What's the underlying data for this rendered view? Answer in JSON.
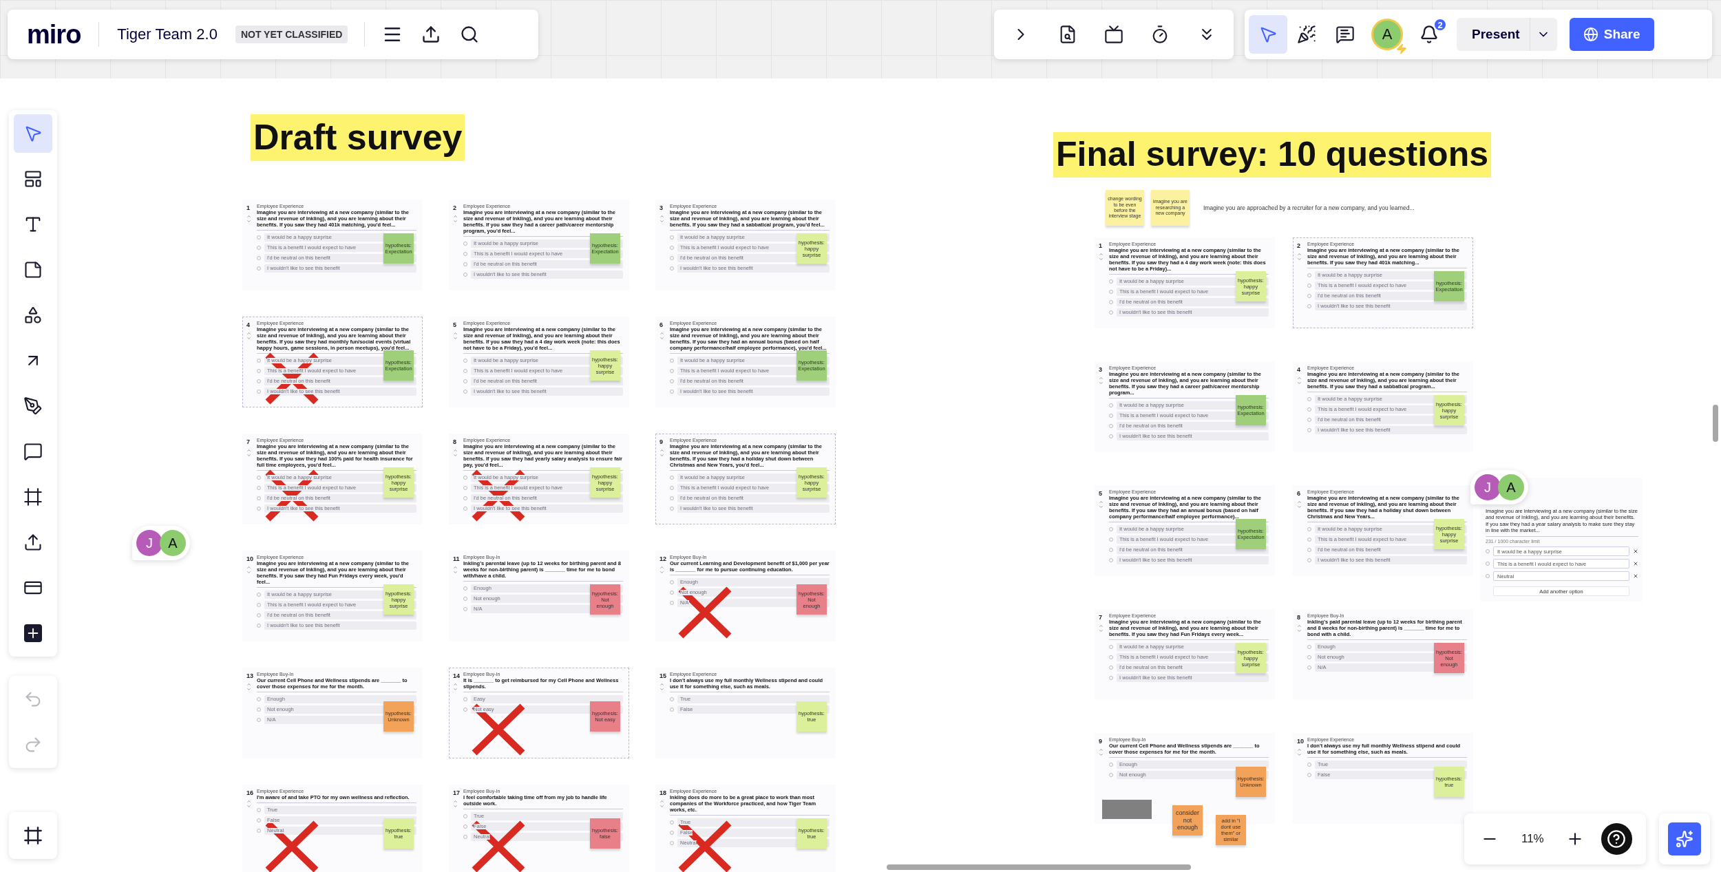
{
  "header": {
    "logo": "miro",
    "board_title": "Tiger Team 2.0",
    "classification": "NOT YET CLASSIFIED"
  },
  "top_tools": [
    {
      "kind": "expand"
    },
    {
      "kind": "notes"
    },
    {
      "kind": "screen"
    },
    {
      "kind": "timer"
    },
    {
      "kind": "more"
    }
  ],
  "collab_tools": [
    {
      "kind": "pointer",
      "selected": true
    },
    {
      "kind": "reactions",
      "selected": false
    },
    {
      "kind": "comments",
      "selected": false
    }
  ],
  "user": {
    "initial": "A"
  },
  "notifications": {
    "count": "2"
  },
  "present_button": "Present",
  "share_button": "Share",
  "left_tools": [
    {
      "kind": "select",
      "selected": true
    },
    {
      "kind": "templates",
      "selected": false
    },
    {
      "kind": "text",
      "selected": false
    },
    {
      "kind": "sticky",
      "selected": false
    },
    {
      "kind": "shapes",
      "selected": false
    },
    {
      "kind": "arrow",
      "selected": false
    },
    {
      "kind": "pen",
      "selected": false
    },
    {
      "kind": "comment",
      "selected": false
    },
    {
      "kind": "frame",
      "selected": false
    },
    {
      "kind": "upload",
      "selected": false
    },
    {
      "kind": "card",
      "selected": false
    },
    {
      "kind": "add",
      "selected": false
    }
  ],
  "history_tools": [
    {
      "kind": "undo",
      "disabled": true
    },
    {
      "kind": "redo",
      "disabled": true
    }
  ],
  "zoom": {
    "level_text": "11%"
  },
  "draft": {
    "heading": "Draft survey",
    "cards": [
      {
        "number": "1",
        "category": "Employee Experience",
        "question": "Imagine you are interviewing at a new company (similar to the size and revenue of Inkling), and you are learning about their benefits. If you saw they had 401k matching, you'd feel...",
        "options": [
          "It would be a happy surprise",
          "This is a benefit I would expect to have",
          "I'd be neutral on this benefit",
          "I wouldn't like to see this benefit"
        ],
        "sticky": {
          "text": "hypothesis: Expectation",
          "color": "#9fcf7a"
        },
        "crossed": false,
        "framed": false
      },
      {
        "number": "2",
        "category": "Employee Experience",
        "question": "Imagine you are interviewing at a new company (similar to the size and revenue of Inkling), and you are learning about their benefits. If you saw they had a career path/career mentorship program, you'd feel...",
        "options": [
          "It would be a happy surprise",
          "This is a benefit I would expect to have",
          "I'd be neutral on this benefit",
          "I wouldn't like to see this benefit"
        ],
        "sticky": {
          "text": "hypothesis: Expectation",
          "color": "#9fcf7a"
        },
        "crossed": false,
        "framed": false
      },
      {
        "number": "3",
        "category": "Employee Experience",
        "question": "Imagine you are interviewing at a new company (similar to the size and revenue of Inkling), and you are learning about their benefits. If you saw they had a sabbatical program, you'd feel...",
        "options": [
          "It would be a happy surprise",
          "This is a benefit I would expect to have",
          "I'd be neutral on this benefit",
          "I wouldn't like to see this benefit"
        ],
        "sticky": {
          "text": "hypothesis: happy surprise",
          "color": "#dcef9a"
        },
        "crossed": false,
        "framed": false
      },
      {
        "number": "4",
        "category": "Employee Experience",
        "question": "Imagine you are interviewing at a new company (similar to the size and revenue of Inkling), and you are learning about their benefits. If you saw they had monthly fun/social events (virtual happy hours, game sessions, in person meetups), you'd feel...",
        "options": [
          "It would be a happy surprise",
          "This is a benefit I would expect to have",
          "I'd be neutral on this benefit",
          "I wouldn't like to see this benefit"
        ],
        "sticky": {
          "text": "hypothesis: Expectation",
          "color": "#9fcf7a"
        },
        "crossed": true,
        "framed": true
      },
      {
        "number": "5",
        "category": "Employee Experience",
        "question": "Imagine you are interviewing at a new company (similar to the size and revenue of Inkling), and you are learning about their benefits. If you saw they had a 4 day work week (note: this does not have to be a Friday), you'd feel...",
        "options": [
          "It would be a happy surprise",
          "This is a benefit I would expect to have",
          "I'd be neutral on this benefit",
          "I wouldn't like to see this benefit"
        ],
        "sticky": {
          "text": "hypothesis: happy surprise",
          "color": "#dcef9a"
        },
        "crossed": false,
        "framed": false
      },
      {
        "number": "6",
        "category": "Employee Experience",
        "question": "Imagine you are interviewing at a new company (similar to the size and revenue of Inkling), and you are learning about their benefits. If you saw they had an annual bonus (based on half company performance/half employee performance), you'd feel...",
        "options": [
          "It would be a happy surprise",
          "This is a benefit I would expect to have",
          "I'd be neutral on this benefit",
          "I wouldn't like to see this benefit"
        ],
        "sticky": {
          "text": "hypothesis: Expectation",
          "color": "#9fcf7a"
        },
        "crossed": false,
        "framed": false
      },
      {
        "number": "7",
        "category": "Employee Experience",
        "question": "Imagine you are interviewing at a new company (similar to the size and revenue of Inkling), and you are learning about their benefits. If you saw they had 100% paid for health insurance for full time employees, you'd feel...",
        "options": [
          "It would be a happy surprise",
          "This is a benefit I would expect to have",
          "I'd be neutral on this benefit",
          "I wouldn't like to see this benefit"
        ],
        "sticky": {
          "text": "hypothesis: happy surprise",
          "color": "#dcef9a"
        },
        "crossed": true,
        "framed": false
      },
      {
        "number": "8",
        "category": "Employee Experience",
        "question": "Imagine you are interviewing at a new company (similar to the size and revenue of Inkling), and you are learning about their benefits. If you saw they had yearly salary analysis to ensure fair pay, you'd feel...",
        "options": [
          "It would be a happy surprise",
          "This is a benefit I would expect to have",
          "I'd be neutral on this benefit",
          "I wouldn't like to see this benefit"
        ],
        "sticky": {
          "text": "hypothesis: happy surprise",
          "color": "#dcef9a"
        },
        "crossed": true,
        "framed": false
      },
      {
        "number": "9",
        "category": "Employee Experience",
        "question": "Imagine you are interviewing at a new company (similar to the size and revenue of Inkling), and you are learning about their benefits. If you saw they had a holiday shut down between Christmas and New Years, you'd feel...",
        "options": [
          "It would be a happy surprise",
          "This is a benefit I would expect to have",
          "I'd be neutral on this benefit",
          "I wouldn't like to see this benefit"
        ],
        "sticky": {
          "text": "hypothesis: happy surprise",
          "color": "#dcef9a"
        },
        "crossed": false,
        "framed": true
      },
      {
        "number": "10",
        "category": "Employee Experience",
        "question": "Imagine you are interviewing at a new company (similar to the size and revenue of Inkling), and you are learning about their benefits. If you saw they had Fun Fridays every week, you'd feel...",
        "options": [
          "It would be a happy surprise",
          "This is a benefit I would expect to have",
          "I'd be neutral on this benefit",
          "I wouldn't like to see this benefit"
        ],
        "sticky": {
          "text": "hypothesis: happy surprise",
          "color": "#dcef9a"
        },
        "crossed": false,
        "framed": false
      },
      {
        "number": "11",
        "category": "Employee Buy-In",
        "question": "Inkling's parental leave (up to 12 weeks for birthing parent and 8 weeks for non-birthing parent) is _______ time for me to bond with/have a child.",
        "options": [
          "Enough",
          "Not enough",
          "N/A"
        ],
        "sticky": {
          "text": "hypothesis: Not enough",
          "color": "#e8808a"
        },
        "crossed": false,
        "framed": false
      },
      {
        "number": "12",
        "category": "Employee Buy-In",
        "question": "Our current Learning and Development benefit of $1,000 per year is _______ for me to pursue continuing education.",
        "options": [
          "Enough",
          "Not enough",
          "N/A"
        ],
        "sticky": {
          "text": "hypothesis: Not enough",
          "color": "#e8808a"
        },
        "crossed": true,
        "framed": false
      },
      {
        "number": "13",
        "category": "Employee Buy-In",
        "question": "Our current Cell Phone and Wellness stipends are _______ to cover those expenses for me for the month.",
        "options": [
          "Enough",
          "Not enough",
          "N/A"
        ],
        "sticky": {
          "text": "hypothesis: Unknown",
          "color": "#f3a25a"
        },
        "crossed": false,
        "framed": false
      },
      {
        "number": "14",
        "category": "Employee Buy-In",
        "question": "It is _______ to get reimbursed for my Cell Phone and Wellness stipends.",
        "options": [
          "Easy",
          "Not easy"
        ],
        "sticky": {
          "text": "hypothesis: Not easy",
          "color": "#e8808a"
        },
        "crossed": true,
        "framed": true
      },
      {
        "number": "15",
        "category": "Employee Experience",
        "question": "I don't always use my full monthly Wellness stipend and could use it for something else, such as meals.",
        "options": [
          "True",
          "False"
        ],
        "sticky": {
          "text": "hypothesis: true",
          "color": "#dcef9a"
        },
        "crossed": false,
        "framed": false
      },
      {
        "number": "16",
        "category": "Employee Experience",
        "question": "I'm aware of and take PTO for my own wellness and reflection.",
        "options": [
          "True",
          "False",
          "Neutral"
        ],
        "sticky": {
          "text": "hypothesis: true",
          "color": "#dcef9a"
        },
        "crossed": true,
        "framed": false
      },
      {
        "number": "17",
        "category": "Employee Buy-In",
        "question": "I feel comfortable taking time off from my job to handle life outside work.",
        "options": [
          "True",
          "False",
          "Neutral"
        ],
        "sticky": {
          "text": "hypothesis: false",
          "color": "#e8808a"
        },
        "crossed": true,
        "framed": false
      },
      {
        "number": "18",
        "category": "Employee Experience",
        "question": "Inkling does do more to be a great place to work than most companies of the Workforce practiced, and how Tiger Team works, etc.",
        "options": [
          "True",
          "False",
          "Neutral"
        ],
        "sticky": {
          "text": "hypothesis: true",
          "color": "#dcef9a"
        },
        "crossed": true,
        "framed": false
      }
    ]
  },
  "final": {
    "heading": "Final survey: 10 questions",
    "notes": [
      {
        "text": "change wording to be even before the interview stage",
        "color": "#fbf1a0"
      },
      {
        "text": "imagine you are researching a new company",
        "color": "#fbf1a0"
      }
    ],
    "intro": "Imagine you are approached by a recruiter for a new company, and you learned...",
    "cards": [
      {
        "number": "1",
        "category": "Employee Experience",
        "question": "Imagine you are interviewing at a new company (similar to the size and revenue of Inkling), and you are learning about their benefits. If you saw they had a 4 day work week (note: this does not have to be a Friday)...",
        "options": [
          "It would be a happy surprise",
          "This is a benefit I would expect to have",
          "I'd be neutral on this benefit",
          "I wouldn't like to see this benefit"
        ],
        "sticky": {
          "text": "hypothesis: happy surprise",
          "color": "#dcef9a"
        },
        "crossed": false,
        "framed": false
      },
      {
        "number": "2",
        "category": "Employee Experience",
        "question": "Imagine you are interviewing at a new company (similar to the size and revenue of Inkling), and you are learning about their benefits. If you saw they had 401k matching...",
        "options": [
          "It would be a happy surprise",
          "This is a benefit I would expect to have",
          "I'd be neutral on this benefit",
          "I wouldn't like to see this benefit"
        ],
        "sticky": {
          "text": "hypothesis: Expectation",
          "color": "#9fcf7a"
        },
        "crossed": false,
        "framed": true
      },
      {
        "number": "3",
        "category": "Employee Experience",
        "question": "Imagine you are interviewing at a new company (similar to the size and revenue of Inkling), and you are learning about their benefits. If you saw they had a career path/career mentorship program...",
        "options": [
          "It would be a happy surprise",
          "This is a benefit I would expect to have",
          "I'd be neutral on this benefit",
          "I wouldn't like to see this benefit"
        ],
        "sticky": {
          "text": "hypothesis: Expectation",
          "color": "#9fcf7a"
        },
        "crossed": false,
        "framed": false
      },
      {
        "number": "4",
        "category": "Employee Experience",
        "question": "Imagine you are interviewing at a new company (similar to the size and revenue of Inkling), and you are learning about their benefits. If you saw they had a sabbatical program...",
        "options": [
          "It would be a happy surprise",
          "This is a benefit I would expect to have",
          "I'd be neutral on this benefit",
          "I wouldn't like to see this benefit"
        ],
        "sticky": {
          "text": "hypothesis: happy surprise",
          "color": "#dcef9a"
        },
        "crossed": false,
        "framed": false
      },
      {
        "number": "5",
        "category": "Employee Experience",
        "question": "Imagine you are interviewing at a new company (similar to the size and revenue of Inkling), and you are learning about their benefits. If you saw they had an annual bonus (based on half company performance/half employee performance)...",
        "options": [
          "It would be a happy surprise",
          "This is a benefit I would expect to have",
          "I'd be neutral on this benefit",
          "I wouldn't like to see this benefit"
        ],
        "sticky": {
          "text": "hypothesis: Expectation",
          "color": "#9fcf7a"
        },
        "crossed": false,
        "framed": false
      },
      {
        "number": "6",
        "category": "Employee Experience",
        "question": "Imagine you are interviewing at a new company (similar to the size and revenue of Inkling), and you are learning about their benefits. If you saw they had a holiday shut down between Christmas and New Years...",
        "options": [
          "It would be a happy surprise",
          "This is a benefit I would expect to have",
          "I'd be neutral on this benefit",
          "I wouldn't like to see this benefit"
        ],
        "sticky": {
          "text": "hypothesis: happy surprise",
          "color": "#dcef9a"
        },
        "crossed": false,
        "framed": false
      },
      {
        "number": "7",
        "category": "Employee Experience",
        "question": "Imagine you are interviewing at a new company (similar to the size and revenue of Inkling), and you are learning about their benefits. If you saw they had Fun Fridays every week...",
        "options": [
          "It would be a happy surprise",
          "This is a benefit I would expect to have",
          "I'd be neutral on this benefit",
          "I wouldn't like to see this benefit"
        ],
        "sticky": {
          "text": "hypothesis: happy surprise",
          "color": "#dcef9a"
        },
        "crossed": false,
        "framed": false
      },
      {
        "number": "8",
        "category": "Employee Buy-In",
        "question": "Inkling's paid parental leave (up to 12 weeks for birthing parent and 8 weeks for non-birthing parent) is _______ time for me to bond with a child.",
        "options": [
          "Enough",
          "Not enough",
          "N/A"
        ],
        "sticky": {
          "text": "hypothesis: Not enough",
          "color": "#e8808a"
        },
        "crossed": false,
        "framed": false
      },
      {
        "number": "9",
        "category": "Employee Buy-In",
        "question": "Our current Cell Phone and Wellness stipends are _______ to cover those expenses for me for the month.",
        "options": [
          "Enough",
          "Not enough"
        ],
        "sticky": {
          "text": "Hypothesis: Unknown",
          "color": "#f3a25a"
        },
        "crossed": false,
        "framed": false,
        "redacted": true,
        "extra_notes": [
          {
            "text": "consider not enough",
            "color": "#f3a25a"
          },
          {
            "text": "add in \"i dont use them\" or similar",
            "color": "#f3a25a"
          }
        ]
      },
      {
        "number": "10",
        "category": "Employee Experience",
        "question": "I don't always use my full monthly Wellness stipend and could use it for something else, such as meals.",
        "options": [
          "True",
          "False"
        ],
        "sticky": {
          "text": "hypothesis: true",
          "color": "#dcef9a"
        },
        "crossed": false,
        "framed": false
      }
    ]
  },
  "editing_card": {
    "question": "Imagine you are interviewing at a new company (similar to the size and revenue of Inkling), and you are learning about their benefits. If you saw they had a year salary analysis to make sure they stay in line with the market...",
    "char_limit": "231 / 1000 character limit",
    "options": [
      "It would be a happy surprise",
      "This is a benefit I would expect to have",
      "Neutral"
    ],
    "add_option": "Add another option"
  },
  "collaborator_groups": [
    [
      {
        "initial": "J",
        "color": "#b65bb8"
      },
      {
        "initial": "A",
        "color": "#8ccb6e"
      }
    ],
    [
      {
        "initial": "J",
        "color": "#b65bb8"
      },
      {
        "initial": "A",
        "color": "#8ccb6e"
      }
    ]
  ]
}
